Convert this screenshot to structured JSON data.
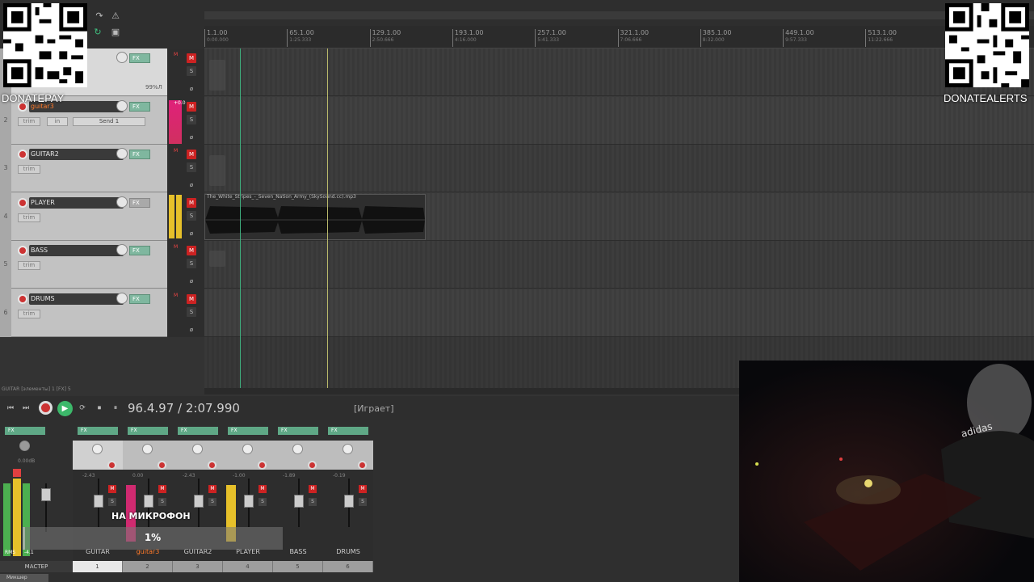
{
  "ruler": {
    "ticks": [
      {
        "bar": "1.1.00",
        "time": "0:00.000"
      },
      {
        "bar": "65.1.00",
        "time": "1:25.333"
      },
      {
        "bar": "129.1.00",
        "time": "2:50.666"
      },
      {
        "bar": "193.1.00",
        "time": "4:16.000"
      },
      {
        "bar": "257.1.00",
        "time": "5:41.333"
      },
      {
        "bar": "321.1.00",
        "time": "7:06.666"
      },
      {
        "bar": "385.1.00",
        "time": "8:32.000"
      },
      {
        "bar": "449.1.00",
        "time": "9:57.333"
      },
      {
        "bar": "513.1.00",
        "time": "11:22.666"
      }
    ]
  },
  "tracks": [
    {
      "num": "1",
      "name": "",
      "fx": "FX",
      "extra": "99%Л",
      "selected": true
    },
    {
      "num": "2",
      "name": "guitar3",
      "fx": "FX",
      "trim": "trim",
      "in": "in",
      "send": "Send 1",
      "level": "+0.0"
    },
    {
      "num": "3",
      "name": "GUITAR2",
      "fx": "FX",
      "trim": "trim"
    },
    {
      "num": "4",
      "name": "PLAYER",
      "fx": "FX",
      "trim": "trim"
    },
    {
      "num": "5",
      "name": "BASS",
      "fx": "FX",
      "trim": "trim"
    },
    {
      "num": "6",
      "name": "DRUMS",
      "fx": "FX",
      "trim": "trim"
    }
  ],
  "track_buttons": {
    "mute": "M",
    "solo": "S",
    "phase": "ø"
  },
  "item": {
    "name": "The_White_Stripes_-_Seven_Nation_Army_(SkySound.cc).mp3"
  },
  "status_line": "GUITAR [элементы] 1 [FX] 5",
  "transport": {
    "position": "96.4.97 / 2:07.990",
    "state": "[Играет]",
    "buttons": [
      "⏮",
      "⏭",
      "⏹",
      "⏸"
    ]
  },
  "mixer": {
    "master_label": "МАСТЕР",
    "master_db": "0.00dB",
    "rms": "RMS",
    "rms_val": "-4.1",
    "tab": "Микшер",
    "channels": [
      {
        "name": "GUITAR",
        "num": "1",
        "db": "-2.43",
        "fx": "FX"
      },
      {
        "name": "guitar3",
        "num": "2",
        "db": "0.00",
        "fx": "FX"
      },
      {
        "name": "GUITAR2",
        "num": "3",
        "db": "-2.43",
        "fx": "FX"
      },
      {
        "name": "PLAYER",
        "num": "4",
        "db": "-1.00",
        "fx": "FX"
      },
      {
        "name": "BASS",
        "num": "5",
        "db": "-1.89",
        "fx": "FX"
      },
      {
        "name": "DRUMS",
        "num": "6",
        "db": "-0.19",
        "fx": "FX"
      }
    ]
  },
  "overlay": {
    "mic_label": "НА МИКРОФОН",
    "progress_text": "1%",
    "progress_value": 0.01
  },
  "donations": {
    "left": "DONATEPAY",
    "right": "DONATEALERTS"
  },
  "colors": {
    "rec": "#cc3333",
    "play": "#3cb86a",
    "fx": "#7fb79f",
    "mute": "#cc2222"
  }
}
